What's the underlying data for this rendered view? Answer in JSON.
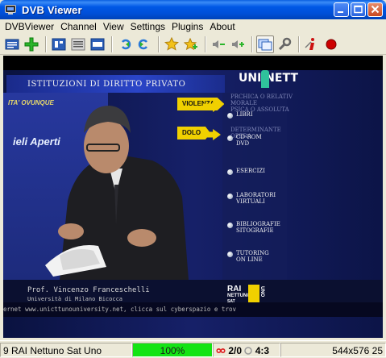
{
  "window": {
    "title": "DVB Viewer",
    "buttons": {
      "minimize": "_",
      "maximize": "□",
      "close": "×"
    }
  },
  "menu": [
    "DVBViewer",
    "Channel",
    "View",
    "Settings",
    "Plugins",
    "About"
  ],
  "toolbar": {
    "icons": [
      "channel-list-icon",
      "add-icon",
      "teletext-icon",
      "epg-list-icon",
      "epg-icon",
      "back-icon",
      "forward-icon",
      "favorites-icon",
      "add-favorite-icon",
      "volume-down-icon",
      "volume-up-icon",
      "fullscreen-icon",
      "settings-wrench-icon",
      "info-icon",
      "record-icon"
    ]
  },
  "video": {
    "header": "ISTITUZIONI DI DIRITTO PRIVATO",
    "brand": "UNI NETT",
    "tag": "ITA' OVUNQUE",
    "aperti": "ieli Aperti",
    "labels": [
      "VIOLENZA",
      "DOLO"
    ],
    "faded_items": [
      "PRCHICA O RELATIV\nMORALE\nPSICA O ASSOLUTA",
      "DETERMINANTE\nOPERA"
    ],
    "menu_items": [
      "LIBRI",
      "CD-ROM\nDVD",
      "ESERCIZI",
      "LABORATORI\nVIRTUALI",
      "BIBLIOGRAFIE\nSITOGRAFIE",
      "TUTORING\nON LINE"
    ],
    "name": "Prof. Vincenzo Franceschelli",
    "university": "Università di Milano Bicocca",
    "logo": {
      "line1": "RAI",
      "line2": "NETTUNO",
      "line3": "SAT",
      "uno": "UNO"
    },
    "ticker": "ernet www.unicttunouniversity.net, clicca sul cyberspazio e trov"
  },
  "status": {
    "channel": "9 RAI Nettuno Sat Uno",
    "signal": "100%",
    "signal_percent": 100,
    "audio": "2/0",
    "aspect": "4:3",
    "resolution": "544x576 25"
  },
  "colors": {
    "titlebar": "#0058e6",
    "progress": "#14e414",
    "record": "#cc0000"
  }
}
